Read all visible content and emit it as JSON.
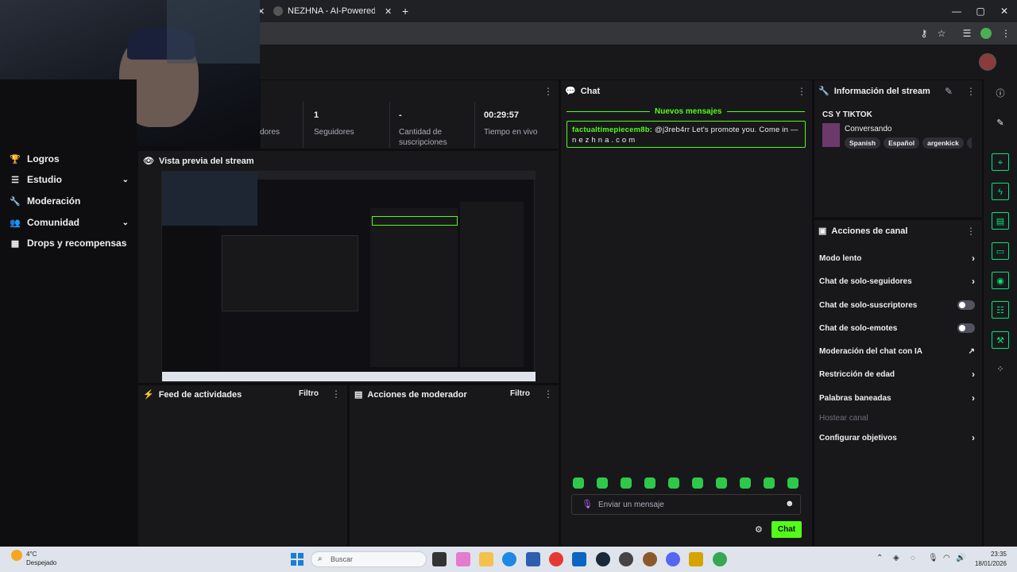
{
  "browser": {
    "tab_title": "NEZHNA - AI-Powered Live Str",
    "new_tab_icon": "plus-icon"
  },
  "stats": {
    "followers_label_partial": "dores",
    "followers_value": "1",
    "followers_label": "Seguidores",
    "subs_value": "-",
    "subs_label": "Cantidad de suscripciones",
    "live_time_value": "00:29:57",
    "live_time_label": "Tiempo en vivo"
  },
  "sidebar": {
    "items": [
      {
        "label": "Logros",
        "icon": "trophy-icon"
      },
      {
        "label": "Estudio",
        "icon": "studio-icon"
      },
      {
        "label": "Moderación",
        "icon": "wrench-icon"
      },
      {
        "label": "Comunidad",
        "icon": "community-icon"
      },
      {
        "label": "Drops y recompensas",
        "icon": "drops-icon"
      }
    ]
  },
  "preview": {
    "title": "Vista previa del stream"
  },
  "activity_feed": {
    "title": "Feed de actividades",
    "filter": "Filtro"
  },
  "mod_actions": {
    "title": "Acciones de moderador",
    "filter": "Filtro"
  },
  "chat": {
    "title": "Chat",
    "new_messages": "Nuevos mensajes",
    "message_user": "factualtimepiecem8b:",
    "message_text": "@j3reb4rr Let's promote you. Come in — n e z h n a . c o m",
    "input_placeholder": "Enviar un mensaje",
    "send_label": "Chat",
    "emote_color": "#2ec94a"
  },
  "stream_info": {
    "title": "Información del stream",
    "stream_title": "CS Y TIKTOK",
    "category": "Conversando",
    "tags": [
      "Spanish",
      "Español",
      "argenkick",
      "co"
    ]
  },
  "channel_actions": {
    "title": "Acciones de canal",
    "items": [
      {
        "label": "Modo lento",
        "control": "chevron"
      },
      {
        "label": "Chat de solo-seguidores",
        "control": "chevron"
      },
      {
        "label": "Chat de solo-suscriptores",
        "control": "toggle"
      },
      {
        "label": "Chat de solo-emotes",
        "control": "toggle"
      },
      {
        "label": "Moderación del chat con IA",
        "control": "external"
      },
      {
        "label": "Restricción de edad",
        "control": "chevron"
      },
      {
        "label": "Palabras baneadas",
        "control": "chevron"
      },
      {
        "label": "Hostear canal",
        "control": "disabled"
      },
      {
        "label": "Configurar objetivos",
        "control": "chevron"
      }
    ]
  },
  "taskbar": {
    "weather_temp": "4°C",
    "weather_desc": "Despejado",
    "search_placeholder": "Buscar",
    "time": "23:35",
    "date": "18/01/2026"
  },
  "colors": {
    "accent": "#53fc18",
    "panel_bg": "#18181b",
    "page_bg": "#0e0e10"
  }
}
